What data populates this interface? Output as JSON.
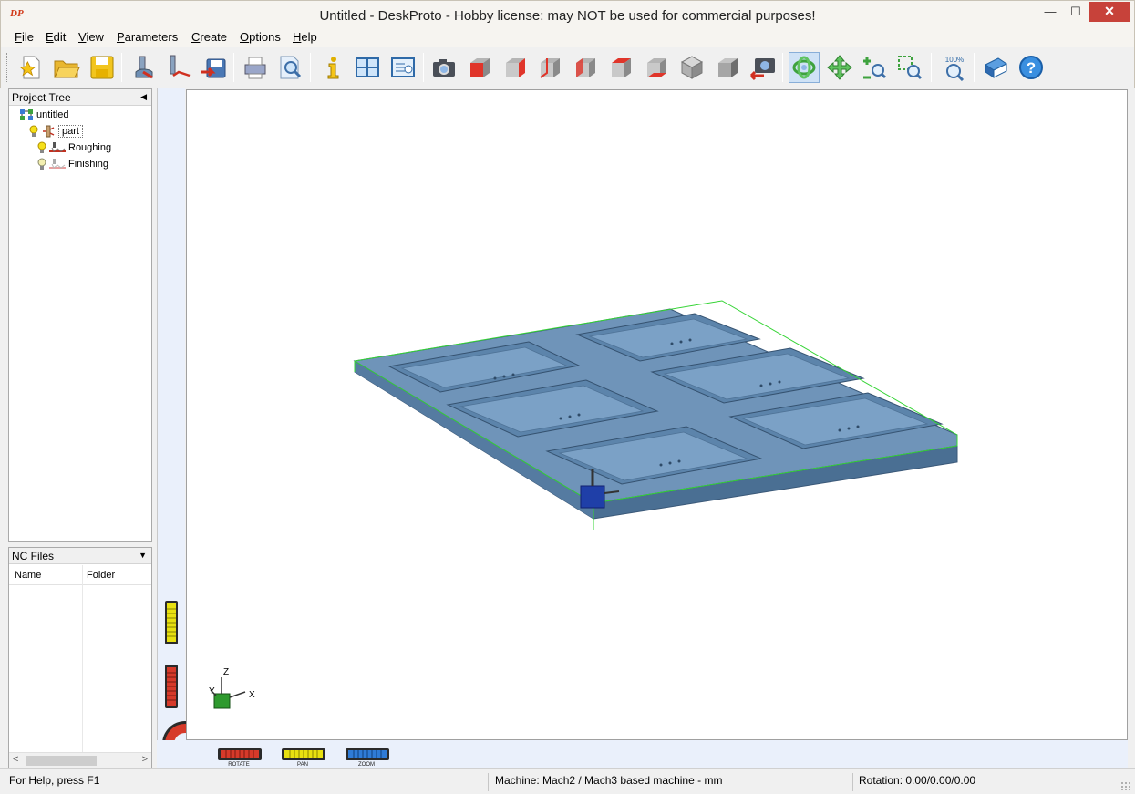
{
  "window": {
    "title": "Untitled - DeskProto - Hobby license: may NOT be used for commercial purposes!",
    "app_icon_text": "DP",
    "minimize_symbol": "—",
    "maximize_symbol": "☐",
    "close_symbol": "✕"
  },
  "menu": [
    {
      "label": "File"
    },
    {
      "label": "Edit"
    },
    {
      "label": "View"
    },
    {
      "label": "Parameters"
    },
    {
      "label": "Create"
    },
    {
      "label": "Options"
    },
    {
      "label": "Help"
    }
  ],
  "toolbar": {
    "buttons": [
      {
        "icon": "new-project-icon"
      },
      {
        "icon": "open-folder-icon"
      },
      {
        "icon": "save-icon"
      },
      {
        "icon": "simulate-icon"
      },
      {
        "icon": "create-toolpath-icon"
      },
      {
        "icon": "save-nc-icon"
      },
      {
        "icon": "print-icon"
      },
      {
        "icon": "print-preview-icon"
      },
      {
        "icon": "info-icon"
      },
      {
        "icon": "view-layout-icon"
      },
      {
        "icon": "view-properties-icon"
      },
      {
        "icon": "screenshot-icon"
      },
      {
        "icon": "view-front-icon"
      },
      {
        "icon": "view-right-icon"
      },
      {
        "icon": "view-back-icon"
      },
      {
        "icon": "view-left-icon"
      },
      {
        "icon": "view-top-icon"
      },
      {
        "icon": "view-bottom-icon"
      },
      {
        "icon": "view-iso-icon"
      },
      {
        "icon": "view-shaded-icon"
      },
      {
        "icon": "previous-view-icon"
      },
      {
        "icon": "rotate-mode-icon",
        "active": true
      },
      {
        "icon": "pan-mode-icon"
      },
      {
        "icon": "zoom-mode-icon"
      },
      {
        "icon": "zoom-window-icon"
      },
      {
        "icon": "zoom-100-icon",
        "text": "100%"
      },
      {
        "icon": "manual-icon"
      },
      {
        "icon": "help-icon",
        "text": "?"
      }
    ]
  },
  "project_tree": {
    "header": "Project Tree",
    "header_arrow": "◀",
    "nodes": [
      {
        "label": "untitled",
        "level": 0
      },
      {
        "label": "part",
        "level": 1,
        "selected": true
      },
      {
        "label": "Roughing",
        "level": 2
      },
      {
        "label": "Finishing",
        "level": 2
      }
    ]
  },
  "nc_files": {
    "header": "NC Files",
    "header_arrow": "▼",
    "columns": [
      "Name",
      "Folder"
    ],
    "scroll_left": "<",
    "scroll_right": ">"
  },
  "viewport": {
    "axes": {
      "z": "Z",
      "y": "Y",
      "x": "X"
    },
    "wheels": [
      {
        "label": "ROTATE",
        "color": "#d63a2a"
      },
      {
        "label": "PAN",
        "color": "#e8e010"
      },
      {
        "label": "ZOOM",
        "color": "#2f7bd6"
      }
    ],
    "part_color": "#6f94b9",
    "bbox_color": "#35d435"
  },
  "statusbar": {
    "help": "For Help, press F1",
    "machine": "Machine: Mach2 / Mach3 based machine - mm",
    "rotation": "Rotation: 0.00/0.00/0.00"
  }
}
